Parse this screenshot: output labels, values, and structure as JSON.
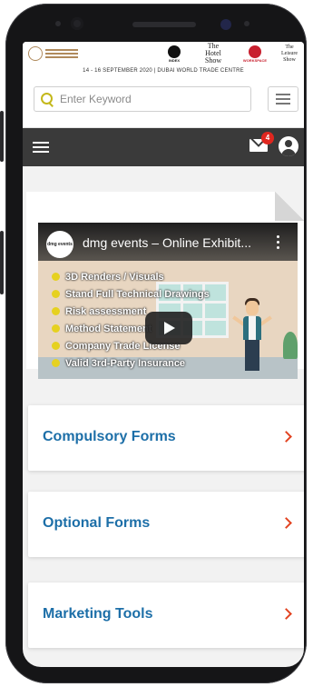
{
  "header": {
    "logos": [
      "INDEX",
      "The Hotel Show",
      "WORKSPACE",
      "The Leisure Show"
    ],
    "event_date_venue": "14 - 16 SEPTEMBER 2020 | DUBAI WORLD TRADE CENTRE"
  },
  "search": {
    "placeholder": "Enter Keyword",
    "value": ""
  },
  "nav": {
    "mail_count": "4"
  },
  "video": {
    "channel": "dmg events",
    "title": "dmg events – Online Exhibit...",
    "checklist": [
      "3D Renders / Visuals",
      "Stand Full Technical Drawings",
      "Risk assessment",
      "Method Statement",
      "Company Trade License",
      "Valid 3rd-Party Insurance"
    ]
  },
  "cards": [
    {
      "label": "Compulsory Forms"
    },
    {
      "label": "Optional Forms"
    },
    {
      "label": "Marketing Tools"
    }
  ],
  "colors": {
    "accent": "#1d6fa8",
    "chevron": "#e24422",
    "navbar": "#3a3a3a",
    "badge": "#e0271f",
    "search_icon": "#c4b81b"
  }
}
